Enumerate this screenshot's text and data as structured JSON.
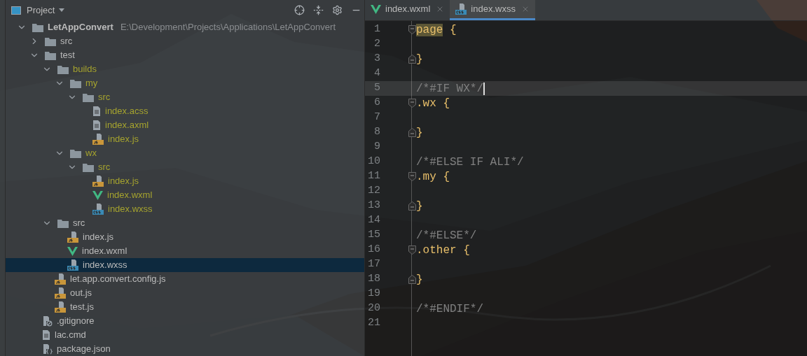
{
  "project_panel": {
    "title": "Project",
    "tree": [
      {
        "label": "LetAppConvert",
        "path": "E:\\Development\\Projects\\Applications\\LetAppConvert",
        "kind": "folder",
        "expanded": true,
        "selected": false,
        "color": "#bbbbbb",
        "children": [
          {
            "label": "src",
            "kind": "folder",
            "expanded": false,
            "selected": false,
            "color": "#bbbbbb"
          },
          {
            "label": "test",
            "kind": "folder",
            "expanded": true,
            "selected": false,
            "color": "#bbbbbb",
            "children": [
              {
                "label": "builds",
                "kind": "folder",
                "expanded": true,
                "selected": false,
                "color": "#a5a32e",
                "children": [
                  {
                    "label": "my",
                    "kind": "folder",
                    "expanded": true,
                    "selected": false,
                    "color": "#a5a32e",
                    "children": [
                      {
                        "label": "src",
                        "kind": "folder",
                        "expanded": true,
                        "selected": false,
                        "color": "#a5a32e",
                        "children": [
                          {
                            "label": "index.acss",
                            "kind": "text",
                            "selected": false,
                            "color": "#a5a32e"
                          },
                          {
                            "label": "index.axml",
                            "kind": "text",
                            "selected": false,
                            "color": "#a5a32e"
                          },
                          {
                            "label": "index.js",
                            "kind": "js",
                            "selected": false,
                            "color": "#a5a32e"
                          }
                        ]
                      }
                    ]
                  },
                  {
                    "label": "wx",
                    "kind": "folder",
                    "expanded": true,
                    "selected": false,
                    "color": "#a5a32e",
                    "children": [
                      {
                        "label": "src",
                        "kind": "folder",
                        "expanded": true,
                        "selected": false,
                        "color": "#a5a32e",
                        "children": [
                          {
                            "label": "index.js",
                            "kind": "js",
                            "selected": false,
                            "color": "#a5a32e"
                          },
                          {
                            "label": "index.wxml",
                            "kind": "vue",
                            "selected": false,
                            "color": "#a5a32e"
                          },
                          {
                            "label": "index.wxss",
                            "kind": "css",
                            "selected": false,
                            "color": "#a5a32e"
                          }
                        ]
                      }
                    ]
                  }
                ]
              },
              {
                "label": "src",
                "kind": "folder",
                "expanded": true,
                "selected": false,
                "color": "#bbbbbb",
                "children": [
                  {
                    "label": "index.js",
                    "kind": "js",
                    "selected": false,
                    "color": "#bbbbbb"
                  },
                  {
                    "label": "index.wxml",
                    "kind": "vue",
                    "selected": false,
                    "color": "#bbbbbb"
                  },
                  {
                    "label": "index.wxss",
                    "kind": "css",
                    "selected": true
                  }
                ]
              },
              {
                "label": "let.app.convert.config.js",
                "kind": "js",
                "selected": false,
                "color": "#bbbbbb"
              },
              {
                "label": "out.js",
                "kind": "js",
                "selected": false,
                "color": "#bbbbbb"
              },
              {
                "label": "test.js",
                "kind": "js",
                "selected": false,
                "color": "#bbbbbb"
              }
            ]
          },
          {
            "label": ".gitignore",
            "kind": "ignore",
            "selected": false,
            "color": "#bbbbbb"
          },
          {
            "label": "lac.cmd",
            "kind": "text",
            "selected": false,
            "color": "#bbbbbb"
          },
          {
            "label": "package.json",
            "kind": "json",
            "selected": false,
            "color": "#bbbbbb"
          }
        ]
      }
    ]
  },
  "editor": {
    "tabs": [
      {
        "label": "index.wxml",
        "kind": "vue",
        "selected": false
      },
      {
        "label": "index.wxss",
        "kind": "css",
        "selected": true
      }
    ],
    "lines": [
      {
        "number": "1",
        "kind": "fold-start",
        "current": false,
        "tokens": [
          {
            "text": "page",
            "kind": "match"
          },
          {
            "text": " {",
            "kind": "brace"
          }
        ]
      },
      {
        "number": "2",
        "kind": "plain",
        "current": false
      },
      {
        "number": "3",
        "kind": "fold-end",
        "current": false,
        "tokens": [
          {
            "text": "}",
            "kind": "brace"
          }
        ]
      },
      {
        "number": "4",
        "kind": "plain",
        "current": false
      },
      {
        "number": "5",
        "kind": "plain",
        "current": true,
        "tokens": [
          {
            "text": "/*#IF WX*/",
            "kind": "comment"
          }
        ]
      },
      {
        "number": "6",
        "kind": "fold-start",
        "current": false,
        "tokens": [
          {
            "text": ".wx",
            "kind": "selector"
          },
          {
            "text": " {",
            "kind": "brace"
          }
        ]
      },
      {
        "number": "7",
        "kind": "plain",
        "current": false
      },
      {
        "number": "8",
        "kind": "fold-end",
        "current": false,
        "tokens": [
          {
            "text": "}",
            "kind": "brace"
          }
        ]
      },
      {
        "number": "9",
        "kind": "plain",
        "current": false
      },
      {
        "number": "10",
        "kind": "plain",
        "current": false,
        "tokens": [
          {
            "text": "/*#ELSE IF ALI*/",
            "kind": "comment"
          }
        ]
      },
      {
        "number": "11",
        "kind": "fold-start",
        "current": false,
        "tokens": [
          {
            "text": ".my",
            "kind": "selector"
          },
          {
            "text": " {",
            "kind": "brace"
          }
        ]
      },
      {
        "number": "12",
        "kind": "plain",
        "current": false
      },
      {
        "number": "13",
        "kind": "fold-end",
        "current": false,
        "tokens": [
          {
            "text": "}",
            "kind": "brace"
          }
        ]
      },
      {
        "number": "14",
        "kind": "plain",
        "current": false
      },
      {
        "number": "15",
        "kind": "plain",
        "current": false,
        "tokens": [
          {
            "text": "/*#ELSE*/",
            "kind": "comment"
          }
        ]
      },
      {
        "number": "16",
        "kind": "fold-start",
        "current": false,
        "tokens": [
          {
            "text": ".other",
            "kind": "selector"
          },
          {
            "text": " {",
            "kind": "brace"
          }
        ]
      },
      {
        "number": "17",
        "kind": "plain",
        "current": false
      },
      {
        "number": "18",
        "kind": "fold-end",
        "current": false,
        "tokens": [
          {
            "text": "}",
            "kind": "brace"
          }
        ]
      },
      {
        "number": "19",
        "kind": "plain",
        "current": false
      },
      {
        "number": "20",
        "kind": "plain",
        "current": false,
        "tokens": [
          {
            "text": "/*#ENDIF*/",
            "kind": "comment"
          }
        ]
      },
      {
        "number": "21",
        "kind": "plain",
        "current": false
      }
    ]
  }
}
